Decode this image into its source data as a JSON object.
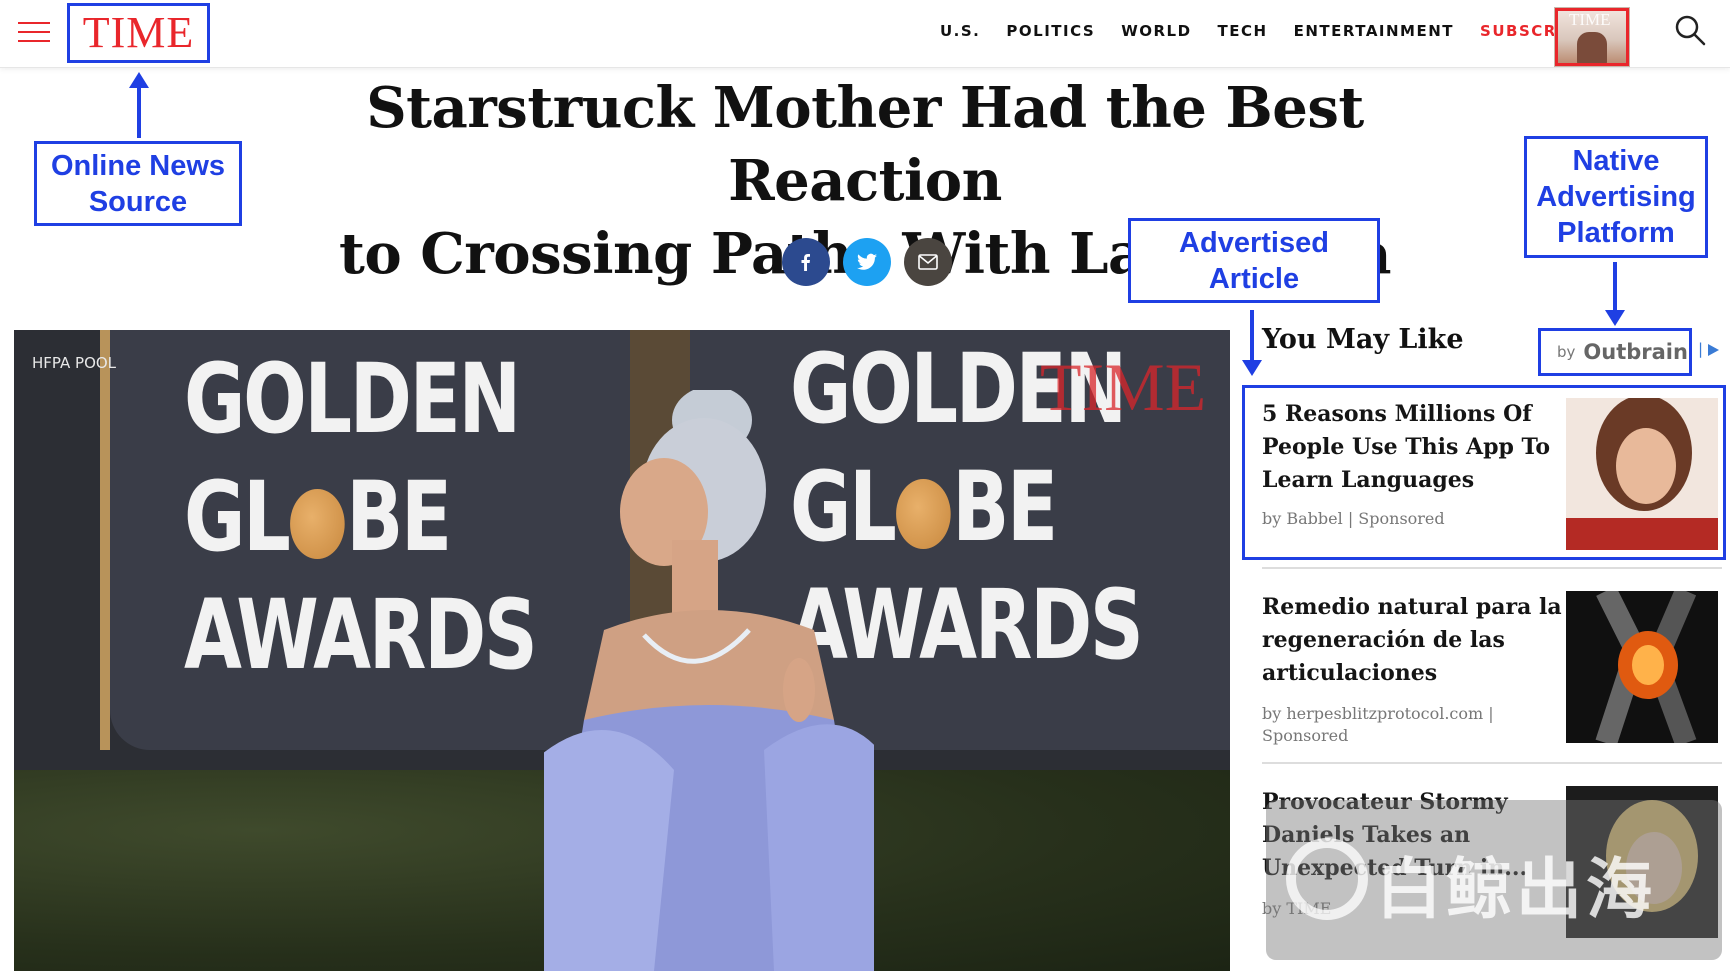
{
  "header": {
    "logo": "TIME",
    "nav": [
      "U.S.",
      "POLITICS",
      "WORLD",
      "TECH",
      "ENTERTAINMENT"
    ],
    "subscribe": "SUBSCRIBE",
    "magazine_logo": "TIME"
  },
  "annotations": {
    "online_news_source_l1": "Online News",
    "online_news_source_l2": "Source",
    "advertised_article_l1": "Advertised",
    "advertised_article_l2": "Article",
    "native_platform_l1": "Native",
    "native_platform_l2": "Advertising",
    "native_platform_l3": "Platform"
  },
  "article": {
    "headline_l1": "Starstruck Mother Had the Best Reaction",
    "headline_l2": "to Crossing Paths With Lady Gaga"
  },
  "video": {
    "credit": "HFPA POOL",
    "watermark": "TIME",
    "backdrop_word1": "GOLDEN",
    "backdrop_word2a": "GL",
    "backdrop_word2b": "BE",
    "backdrop_word3": "AWARDS"
  },
  "sidebar": {
    "title": "You May Like",
    "outbrain_by": "by",
    "outbrain_name": "Outbrain",
    "recommendations": [
      {
        "title": "5 Reasons Millions Of People Use This App To Learn Languages",
        "source": "by Babbel | Sponsored"
      },
      {
        "title": "Remedio natural para la regeneración de las articulaciones",
        "source": "by herpesblitzprotocol.com | Sponsored"
      },
      {
        "title": "Provocateur Stormy Daniels Takes an Unexpected Turn in...",
        "source": "by TIME"
      }
    ]
  },
  "overlay_watermark": "白鲸出海",
  "colors": {
    "accent_red": "#e9262b",
    "annotation_blue": "#1f3fe3",
    "facebook": "#2c4a8f",
    "twitter": "#1da1f2",
    "email": "#4a4540"
  }
}
